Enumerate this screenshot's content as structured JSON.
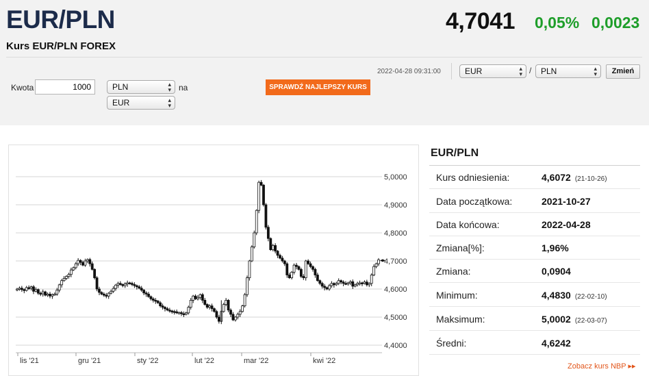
{
  "header": {
    "title": "EUR/PLN",
    "subtitle": "Kurs EUR/PLN FOREX",
    "price": "4,7041",
    "change_pct": "0,05%",
    "change_abs": "0,0023",
    "change_color": "#1e9e2a"
  },
  "converter": {
    "amount_label": "Kwota",
    "amount_value": "1000",
    "from_currency": "PLN",
    "to_currency": "EUR",
    "to_label": "na",
    "check_button": "SPRAWDŹ NAJLEPSZY KURS",
    "button_color": "#f26a1b"
  },
  "pair_switch": {
    "timestamp": "2022-04-28 09:31:00",
    "base": "EUR",
    "separator": "/",
    "quote": "PLN",
    "change_button": "Zmień"
  },
  "chart_data": {
    "type": "candlestick",
    "title": "",
    "x_labels": [
      "lis '21",
      "gru '21",
      "sty '22",
      "lut '22",
      "mar '22",
      "kwi '22"
    ],
    "y_ticks": [
      "4,4000",
      "4,5000",
      "4,6000",
      "4,7000",
      "4,8000",
      "4,9000",
      "5,0000"
    ],
    "ylim": [
      4.4,
      5.05
    ],
    "grid": true,
    "closes": [
      4.6,
      4.603,
      4.598,
      4.595,
      4.605,
      4.603,
      4.608,
      4.592,
      4.598,
      4.585,
      4.583,
      4.59,
      4.578,
      4.582,
      4.575,
      4.58,
      4.582,
      4.596,
      4.615,
      4.63,
      4.638,
      4.645,
      4.652,
      4.668,
      4.676,
      4.69,
      4.702,
      4.695,
      4.685,
      4.7,
      4.705,
      4.69,
      4.67,
      4.64,
      4.6,
      4.588,
      4.582,
      4.578,
      4.575,
      4.585,
      4.592,
      4.602,
      4.614,
      4.62,
      4.616,
      4.612,
      4.618,
      4.622,
      4.62,
      4.616,
      4.612,
      4.608,
      4.603,
      4.596,
      4.586,
      4.582,
      4.573,
      4.565,
      4.56,
      4.557,
      4.551,
      4.54,
      4.535,
      4.53,
      4.525,
      4.522,
      4.52,
      4.519,
      4.515,
      4.516,
      4.512,
      4.51,
      4.515,
      4.535,
      4.56,
      4.575,
      4.565,
      4.57,
      4.58,
      4.56,
      4.545,
      4.535,
      4.54,
      4.53,
      4.52,
      4.5,
      4.485,
      4.52,
      4.545,
      4.56,
      4.525,
      4.51,
      4.49,
      4.5,
      4.51,
      4.52,
      4.54,
      4.58,
      4.64,
      4.7,
      4.75,
      4.8,
      4.88,
      4.98,
      4.97,
      4.9,
      4.82,
      4.78,
      4.74,
      4.755,
      4.735,
      4.72,
      4.71,
      4.7,
      4.69,
      4.65,
      4.64,
      4.66,
      4.685,
      4.68,
      4.67,
      4.645,
      4.64,
      4.7,
      4.69,
      4.68,
      4.67,
      4.65,
      4.63,
      4.62,
      4.61,
      4.605,
      4.6,
      4.612,
      4.62,
      4.615,
      4.62,
      4.63,
      4.625,
      4.62,
      4.618,
      4.622,
      4.626,
      4.61,
      4.615,
      4.62,
      4.622,
      4.62,
      4.625,
      4.615,
      4.62,
      4.65,
      4.68,
      4.69,
      4.704
    ],
    "min": 4.483,
    "max": 5.0002
  },
  "stats": {
    "title": "EUR/PLN",
    "rows": [
      {
        "label": "Kurs odniesienia:",
        "value": "4,6072",
        "sub": "(21-10-26)"
      },
      {
        "label": "Data początkowa:",
        "value": "2021-10-27",
        "sub": ""
      },
      {
        "label": "Data końcowa:",
        "value": "2022-04-28",
        "sub": ""
      },
      {
        "label": "Zmiana[%]:",
        "value": "1,96%",
        "sub": ""
      },
      {
        "label": "Zmiana:",
        "value": "0,0904",
        "sub": ""
      },
      {
        "label": "Minimum:",
        "value": "4,4830",
        "sub": "(22-02-10)"
      },
      {
        "label": "Maksimum:",
        "value": "5,0002",
        "sub": "(22-03-07)"
      },
      {
        "label": "Średni:",
        "value": "4,6242",
        "sub": ""
      }
    ],
    "nbp_link": "Zobacz kurs NBP ▸▸"
  }
}
